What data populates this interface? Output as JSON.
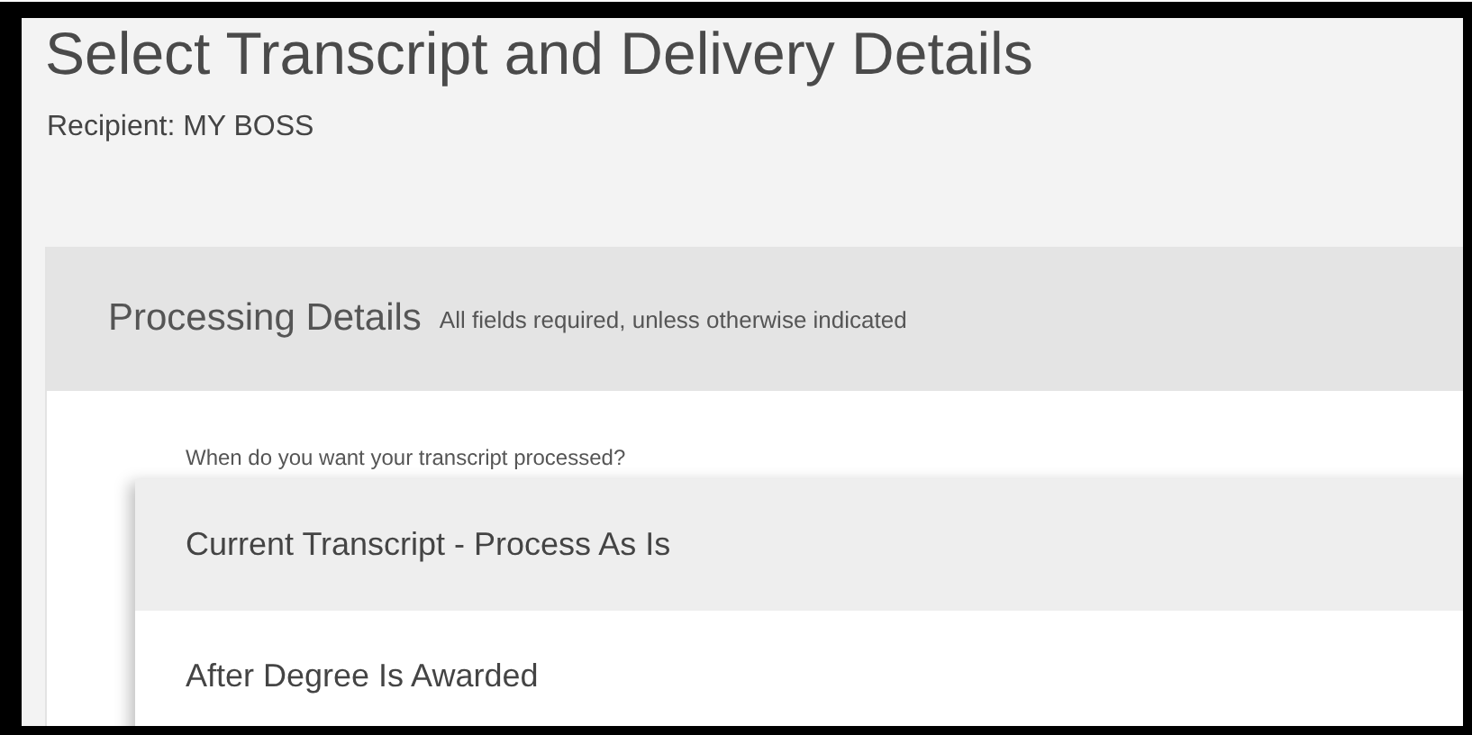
{
  "page": {
    "title": "Select Transcript and Delivery Details",
    "recipient": "Recipient: MY BOSS"
  },
  "card": {
    "title": "Processing Details",
    "note": "All fields required, unless otherwise indicated",
    "field_label": "When do you want your transcript processed?",
    "dropdown": {
      "options": [
        {
          "label": "Current Transcript - Process As Is",
          "selected": true
        },
        {
          "label": "After Degree Is Awarded",
          "selected": false
        }
      ]
    }
  }
}
